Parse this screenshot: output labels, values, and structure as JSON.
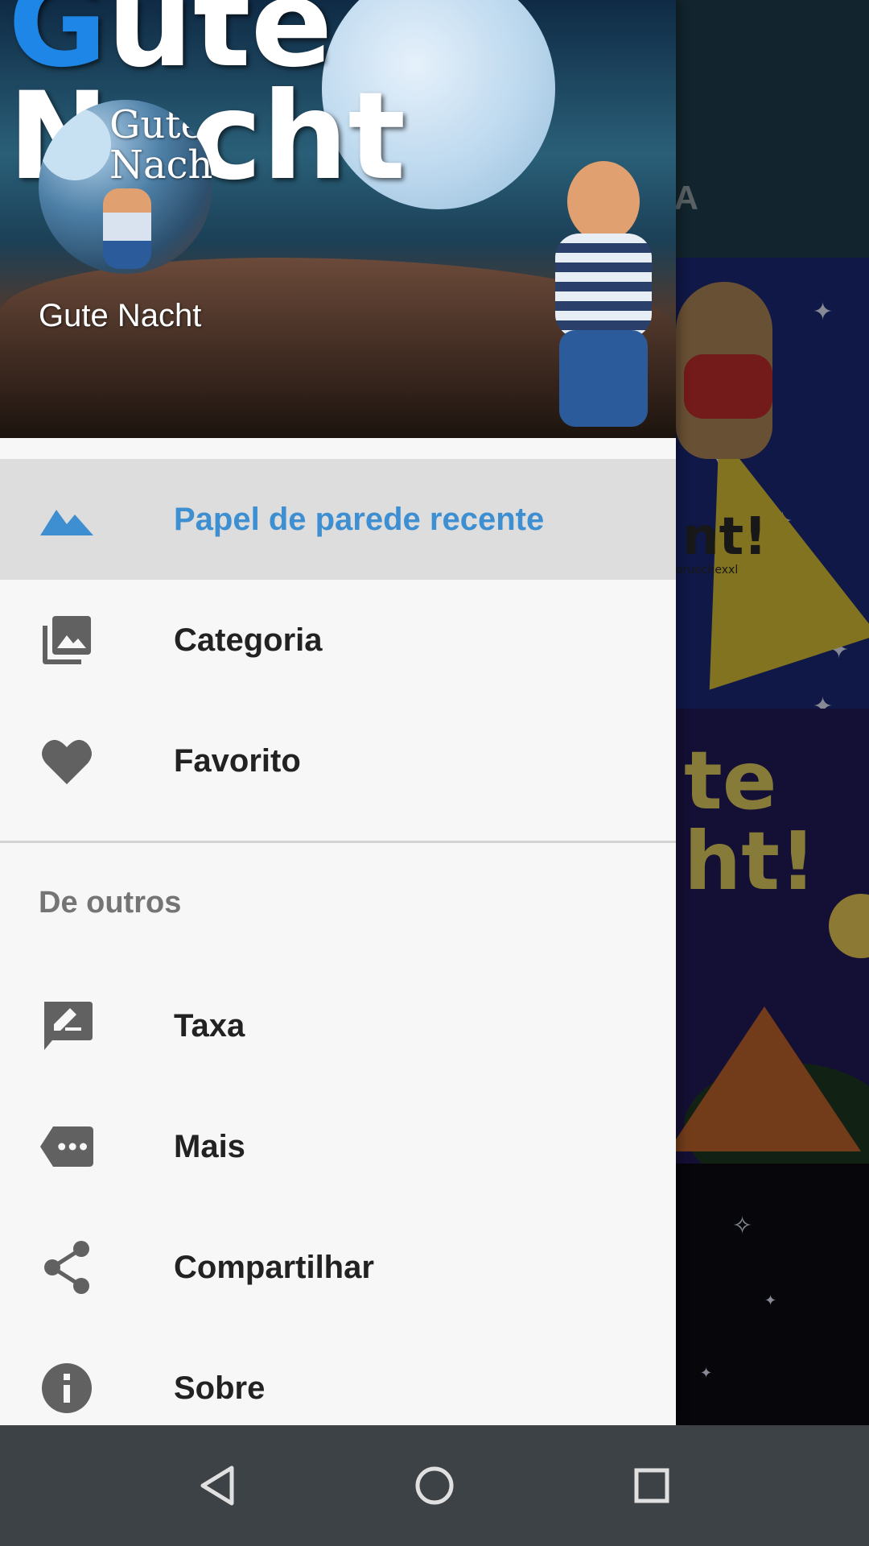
{
  "background": {
    "tab_label": "ORIA",
    "tiles": [
      {
        "text": "nt!",
        "subtext": "oruechexxl"
      },
      {
        "text": "te\nht!"
      },
      {
        "text": ""
      }
    ],
    "toolbar_color": "#1f3f4f"
  },
  "drawer": {
    "header": {
      "big_title": "Gute\nNacht",
      "avatar_text": "Gute\nNacht",
      "title": "Gute Nacht"
    },
    "items": [
      {
        "label": "Papel de parede recente",
        "icon": "landscape-icon",
        "active": true
      },
      {
        "label": "Categoria",
        "icon": "photo-library-icon",
        "active": false
      },
      {
        "label": "Favorito",
        "icon": "heart-icon",
        "active": false
      }
    ],
    "section": {
      "label": "De outros",
      "items": [
        {
          "label": "Taxa",
          "icon": "rate-review-icon"
        },
        {
          "label": "Mais",
          "icon": "more-tag-icon"
        },
        {
          "label": "Compartilhar",
          "icon": "share-icon"
        },
        {
          "label": "Sobre",
          "icon": "info-icon"
        }
      ]
    },
    "colors": {
      "accent": "#3d8fd1",
      "icon": "#616161",
      "active_bg": "#dddddd"
    }
  },
  "navbar": {
    "buttons": [
      "back-icon",
      "home-icon",
      "recents-icon"
    ]
  }
}
